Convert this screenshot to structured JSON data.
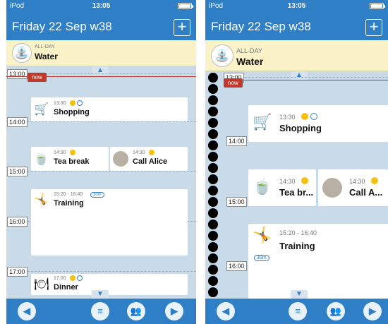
{
  "status": {
    "carrier": "iPod",
    "time": "13:05"
  },
  "nav": {
    "title": "Friday 22 Sep w38",
    "add_label": "+"
  },
  "allday": {
    "label": "ALL-DAY",
    "title": "Water",
    "icon": "sprinkler-icon"
  },
  "now_label": "now",
  "hours": [
    "13:00",
    "14:00",
    "15:00",
    "16:00",
    "17:00"
  ],
  "events": {
    "shopping": {
      "time": "13:30",
      "title": "Shopping",
      "icon": "shopping-cart-icon"
    },
    "tea": {
      "time": "14:30",
      "title": "Tea break",
      "title_short": "Tea br...",
      "icon": "tea-icon"
    },
    "alice": {
      "time": "14:30",
      "title": "Call Alice",
      "title_short": "Call A...",
      "icon": "avatar"
    },
    "training": {
      "time": "15:20 - 16:40",
      "title": "Training",
      "tag": "30m",
      "icon": "running-icon"
    },
    "dinner": {
      "time": "17:00",
      "title": "Dinner",
      "icon": "dinner-icon"
    }
  },
  "toolbar": {
    "prev": "prev-day-icon",
    "list": "list-view-icon",
    "people": "people-icon",
    "next": "next-day-icon"
  },
  "colors": {
    "primary": "#2f7fc7",
    "allday_bg": "#fbf3c8",
    "now": "#c0392b",
    "timeline_bg": "#c9dbe8"
  }
}
